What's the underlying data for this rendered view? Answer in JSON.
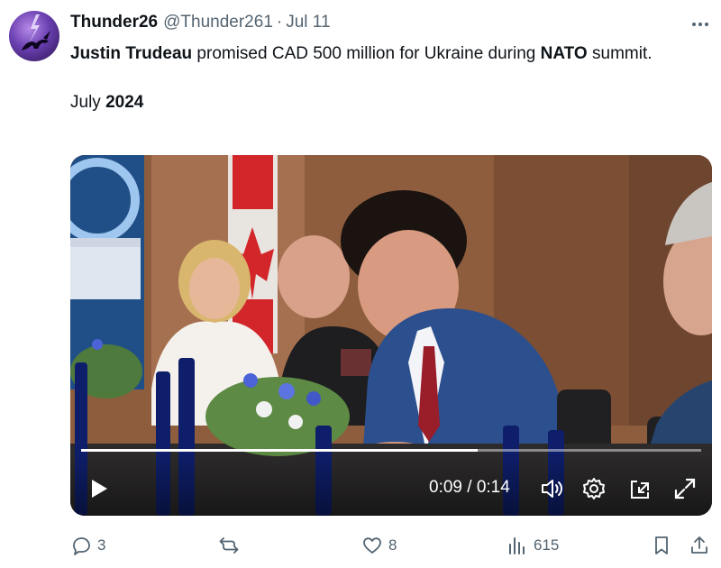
{
  "tweet": {
    "display_name": "Thunder26",
    "handle": "@Thunder261",
    "separator": "·",
    "date": "Jul 11",
    "avatar_icon": "lightning-unicorn-avatar",
    "text": {
      "name": "Justin Trudeau",
      "middle": " promised  CAD 500 million for Ukraine during ",
      "org": "NATO",
      "tail": " summit.",
      "month": "July ",
      "year": "2024"
    }
  },
  "video": {
    "time_current": "0:09",
    "time_separator": " / ",
    "time_total": "0:14",
    "progress_fraction": 0.64,
    "controls": [
      "play-icon",
      "volume-icon",
      "settings-icon",
      "pip-icon",
      "fullscreen-icon"
    ]
  },
  "actions": {
    "replies": "3",
    "reposts": "",
    "likes": "8",
    "views": "615"
  },
  "colors": {
    "text": "#0f1419",
    "secondary": "#536471",
    "video_controls": "#ffffff"
  }
}
